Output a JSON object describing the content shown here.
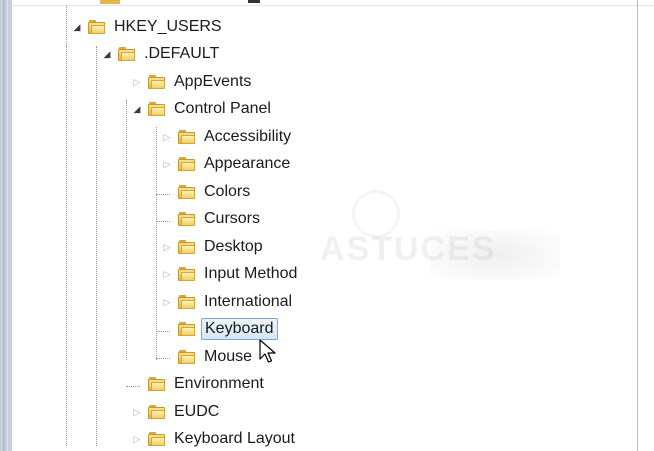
{
  "tree": {
    "items": [
      {
        "label": "HKEY_USERS"
      },
      {
        "label": ".DEFAULT"
      },
      {
        "label": "AppEvents"
      },
      {
        "label": "Control Panel"
      },
      {
        "label": "Accessibility"
      },
      {
        "label": "Appearance"
      },
      {
        "label": "Colors"
      },
      {
        "label": "Cursors"
      },
      {
        "label": "Desktop"
      },
      {
        "label": "Input Method"
      },
      {
        "label": "International"
      },
      {
        "label": "Keyboard"
      },
      {
        "label": "Mouse"
      },
      {
        "label": "Environment"
      },
      {
        "label": "EUDC"
      },
      {
        "label": "Keyboard Layout"
      }
    ]
  },
  "watermark": {
    "text": "ASTUCES"
  },
  "colors": {
    "folder": "#f2cf63",
    "selection_border": "#7aa7d8",
    "selection_fill": "#d5e6f8",
    "text": "#1b1b1b"
  }
}
